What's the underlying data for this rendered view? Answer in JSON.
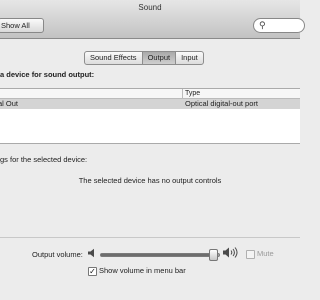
{
  "window": {
    "title": "Sound"
  },
  "toolbar": {
    "show_all_label": "Show All",
    "search_placeholder": ""
  },
  "tabs": [
    {
      "label": "Sound Effects",
      "selected": false
    },
    {
      "label": "Output",
      "selected": true
    },
    {
      "label": "Input",
      "selected": false
    }
  ],
  "output": {
    "heading": "a device for sound output:",
    "columns": {
      "name": "",
      "type": "Type"
    },
    "devices": [
      {
        "name": "al Out",
        "type": "Optical digital-out port",
        "selected": true
      }
    ],
    "settings_label": "gs for the selected device:",
    "no_controls_text": "The selected device has no output controls"
  },
  "volume": {
    "label": "Output volume:",
    "level": 0.95,
    "mute_label": "Mute",
    "mute_checked": false,
    "mute_enabled": false,
    "menu_bar_label": "Show volume in menu bar",
    "menu_bar_checked": true,
    "check_glyph": "✓"
  },
  "icons": {
    "search": "⚲"
  },
  "colors": {
    "window_bg": "#ececec",
    "selection_row": "#d4d4d4"
  }
}
